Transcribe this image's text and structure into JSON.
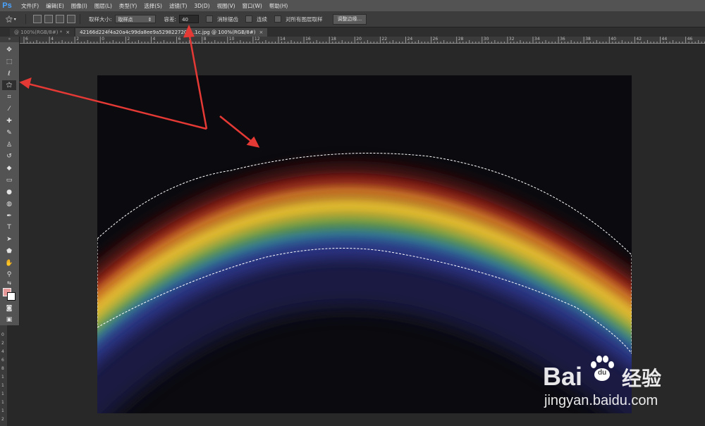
{
  "app": {
    "logo": "Ps"
  },
  "menu": [
    "文件(F)",
    "编辑(E)",
    "图像(I)",
    "图层(L)",
    "类型(Y)",
    "选择(S)",
    "滤镜(T)",
    "3D(D)",
    "视图(V)",
    "窗口(W)",
    "帮助(H)"
  ],
  "options": {
    "sample_size_label": "取样大小:",
    "sample_size_value": "取样点",
    "tolerance_label": "容差:",
    "tolerance_value": "40",
    "antialias_label": "消除锯齿",
    "contiguous_label": "连续",
    "sample_all_label": "对所有图层取样",
    "refine_edge_label": "调整边缘..."
  },
  "tabs": [
    {
      "label": "@ 100%(RGB/8#) *",
      "close": "×"
    },
    {
      "label": "42166d224f4a20a4c99da8ee9a529822720e...1c.jpg @ 100%(RGB/8#)",
      "close": "×"
    }
  ],
  "ruler_top": [
    "6",
    "4",
    "2",
    "0",
    "2",
    "4",
    "6",
    "8",
    "10",
    "12",
    "14",
    "16",
    "18",
    "20",
    "22",
    "24",
    "26",
    "28",
    "30",
    "32",
    "34",
    "36",
    "38",
    "40",
    "42",
    "44",
    "46"
  ],
  "ruler_left": [
    "0",
    "2",
    "4",
    "6",
    "8",
    "1",
    "1",
    "1",
    "1",
    "1",
    "2",
    "2",
    "2",
    "2",
    "2"
  ],
  "toolbar": {
    "tools": [
      "move-tool",
      "marquee-tool",
      "lasso-tool",
      "magic-wand-tool",
      "crop-tool",
      "eyedropper-tool",
      "healing-brush-tool",
      "brush-tool",
      "clone-stamp-tool",
      "history-brush-tool",
      "eraser-tool",
      "gradient-tool",
      "blur-tool",
      "dodge-tool",
      "pen-tool",
      "type-tool",
      "path-selection-tool",
      "shape-tool",
      "hand-tool",
      "zoom-tool"
    ],
    "foreground_color": "#e89a9a",
    "background_color": "#ffffff"
  },
  "colors": {
    "arrow": "#e53935",
    "accent": "#4aa3ff"
  },
  "watermark": {
    "brand": "Bai",
    "brand2": "du",
    "cn": "经验",
    "url": "jingyan.baidu.com"
  }
}
